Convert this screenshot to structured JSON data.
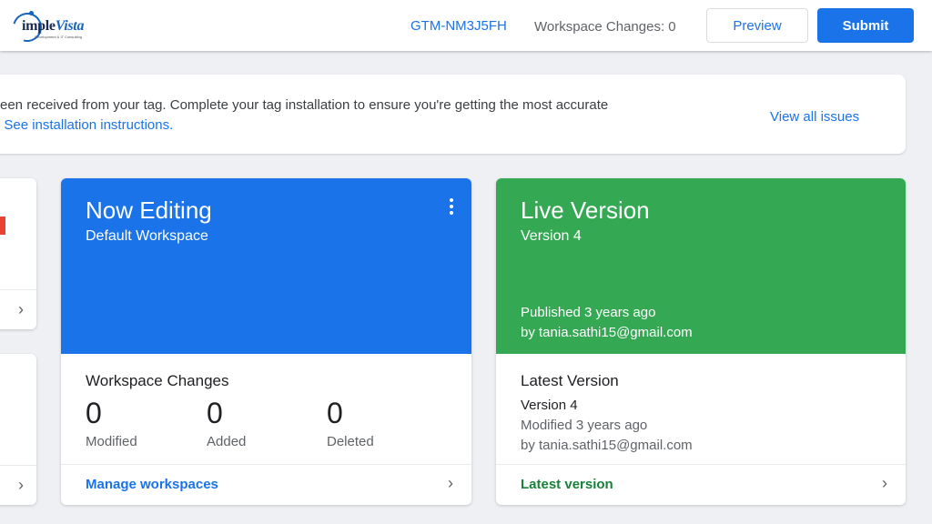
{
  "header": {
    "logo_main": "imple",
    "logo_accent": "Vista",
    "logo_sub": "Development & IT Consulting",
    "container_id": "GTM-NM3J5FH",
    "workspace_changes": "Workspace Changes: 0",
    "preview_label": "Preview",
    "submit_label": "Submit"
  },
  "notice": {
    "line1": "een received from your tag. Complete your tag installation to ensure you're getting the most accurate",
    "line2_prefix": ". ",
    "line2_link": "See installation instructions.",
    "view_all": "View all issues"
  },
  "now_editing": {
    "title": "Now Editing",
    "workspace": "Default Workspace",
    "changes_title": "Workspace Changes",
    "stats": [
      {
        "value": "0",
        "label": "Modified"
      },
      {
        "value": "0",
        "label": "Added"
      },
      {
        "value": "0",
        "label": "Deleted"
      }
    ],
    "footer_link": "Manage workspaces"
  },
  "live_version": {
    "title": "Live Version",
    "version": "Version 4",
    "published": "Published 3 years ago",
    "published_by": "by tania.sathi15@gmail.com",
    "latest_title": "Latest Version",
    "latest_version": "Version 4",
    "latest_modified": "Modified 3 years ago",
    "latest_by": "by tania.sathi15@gmail.com",
    "footer_link": "Latest version"
  },
  "icons": {
    "chevron": "›",
    "more": "more-vert-icon"
  },
  "colors": {
    "accent": "#1a73e8",
    "now_editing_bg": "#1a73e8",
    "live_bg": "#34a853",
    "error": "#ea4335"
  }
}
